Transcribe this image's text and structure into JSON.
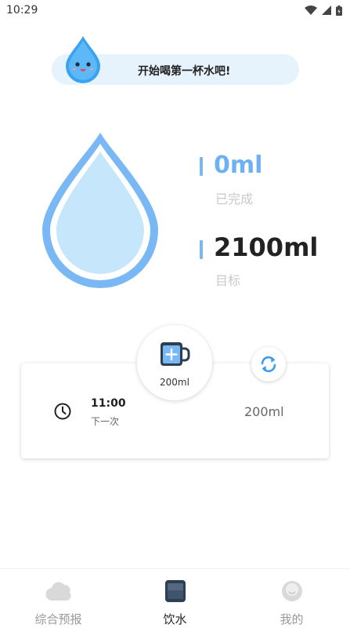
{
  "status_bar": {
    "time": "10:29"
  },
  "banner": {
    "text": "开始喝第一杯水吧!"
  },
  "stats": {
    "completed_value": "0ml",
    "completed_label": "已完成",
    "goal_value": "2100ml",
    "goal_label": "目标"
  },
  "add_button": {
    "label": "200ml"
  },
  "reminder": {
    "next_time": "11:00",
    "next_label": "下一次",
    "cup_size": "200ml"
  },
  "tabs": [
    {
      "label": "综合预报",
      "icon": "cloud-icon",
      "active": false
    },
    {
      "label": "饮水",
      "icon": "cup-icon",
      "active": true
    },
    {
      "label": "我的",
      "icon": "profile-icon",
      "active": false
    }
  ],
  "colors": {
    "accent": "#6db1f2",
    "drop_outer": "#7ab8f5",
    "drop_inner": "#c6e6fb",
    "banner_bg": "#e6f3fd"
  }
}
